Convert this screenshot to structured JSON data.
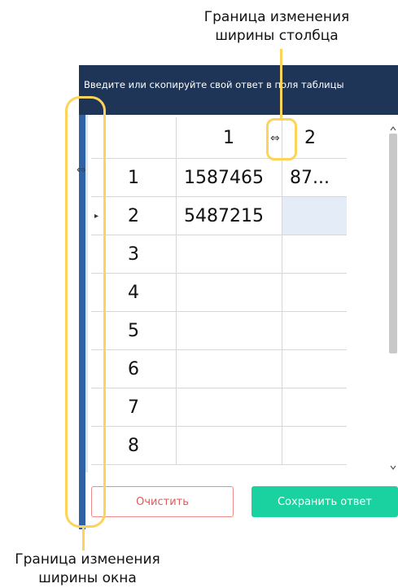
{
  "callouts": {
    "top": [
      "Граница изменения",
      "ширины столбца"
    ],
    "bottom": [
      "Граница изменения",
      "ширины окна"
    ]
  },
  "window": {
    "header_text": "Введите или скопируйте свой ответ в поля таблицы"
  },
  "table": {
    "column_headers": [
      "1",
      "2"
    ],
    "rows": [
      {
        "label": "1",
        "cells": [
          "1587465",
          "87..."
        ]
      },
      {
        "label": "2",
        "cells": [
          "5487215",
          ""
        ]
      },
      {
        "label": "3",
        "cells": [
          "",
          ""
        ]
      },
      {
        "label": "4",
        "cells": [
          "",
          ""
        ]
      },
      {
        "label": "5",
        "cells": [
          "",
          ""
        ]
      },
      {
        "label": "6",
        "cells": [
          "",
          ""
        ]
      },
      {
        "label": "7",
        "cells": [
          "",
          ""
        ]
      },
      {
        "label": "8",
        "cells": [
          "",
          ""
        ]
      }
    ],
    "current_row_marker": "▸",
    "selected_cell_color": "#e4ecf8"
  },
  "buttons": {
    "clear": "Очистить",
    "save": "Сохранить ответ"
  },
  "icons": {
    "column_resize": "⇔",
    "window_resize": "⇔",
    "scroll_up": "▲",
    "scroll_down": "▼"
  },
  "colors": {
    "header_bg": "#1e3558",
    "accent_stripe": "#2f63a6",
    "callout_highlight": "#fdd35a",
    "clear_button_border": "#f08a86",
    "save_button_bg": "#1ad2a0"
  }
}
